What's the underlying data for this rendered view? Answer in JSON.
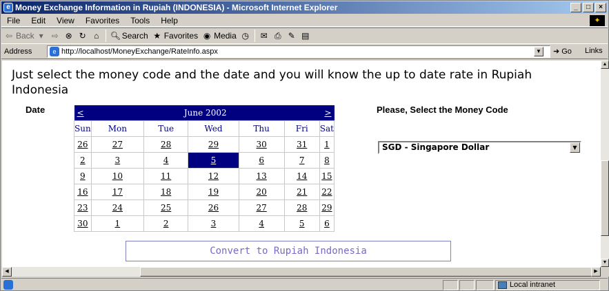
{
  "window": {
    "title": "Money Exchange Information in Rupiah (INDONESIA) - Microsoft Internet Explorer",
    "minimize": "_",
    "maximize": "□",
    "close": "×"
  },
  "menu": [
    "File",
    "Edit",
    "View",
    "Favorites",
    "Tools",
    "Help"
  ],
  "toolbar": {
    "back": "Back",
    "search": "Search",
    "favorites": "Favorites",
    "media": "Media"
  },
  "address": {
    "label": "Address",
    "url": "http://localhost/MoneyExchange/RateInfo.aspx",
    "go": "Go",
    "links": "Links"
  },
  "page": {
    "intro": "Just select the money code and the date and you will know the up to date rate in Rupiah Indonesia",
    "date_label": "Date",
    "money_label": "Please, Select the Money Code",
    "convert_button": "Convert to Rupiah Indonesia"
  },
  "calendar": {
    "prev": "<",
    "next": ">",
    "month_title": "June 2002",
    "weekdays": [
      "Sun",
      "Mon",
      "Tue",
      "Wed",
      "Thu",
      "Fri",
      "Sat"
    ],
    "weeks": [
      [
        "26",
        "27",
        "28",
        "29",
        "30",
        "31",
        "1"
      ],
      [
        "2",
        "3",
        "4",
        "5",
        "6",
        "7",
        "8"
      ],
      [
        "9",
        "10",
        "11",
        "12",
        "13",
        "14",
        "15"
      ],
      [
        "16",
        "17",
        "18",
        "19",
        "20",
        "21",
        "22"
      ],
      [
        "23",
        "24",
        "25",
        "26",
        "27",
        "28",
        "29"
      ],
      [
        "30",
        "1",
        "2",
        "3",
        "4",
        "5",
        "6"
      ]
    ],
    "selected_day": "5",
    "selected_color": "#000080"
  },
  "money_select": {
    "selected": "SGD - Singapore Dollar"
  },
  "status": {
    "zone": "Local intranet"
  }
}
